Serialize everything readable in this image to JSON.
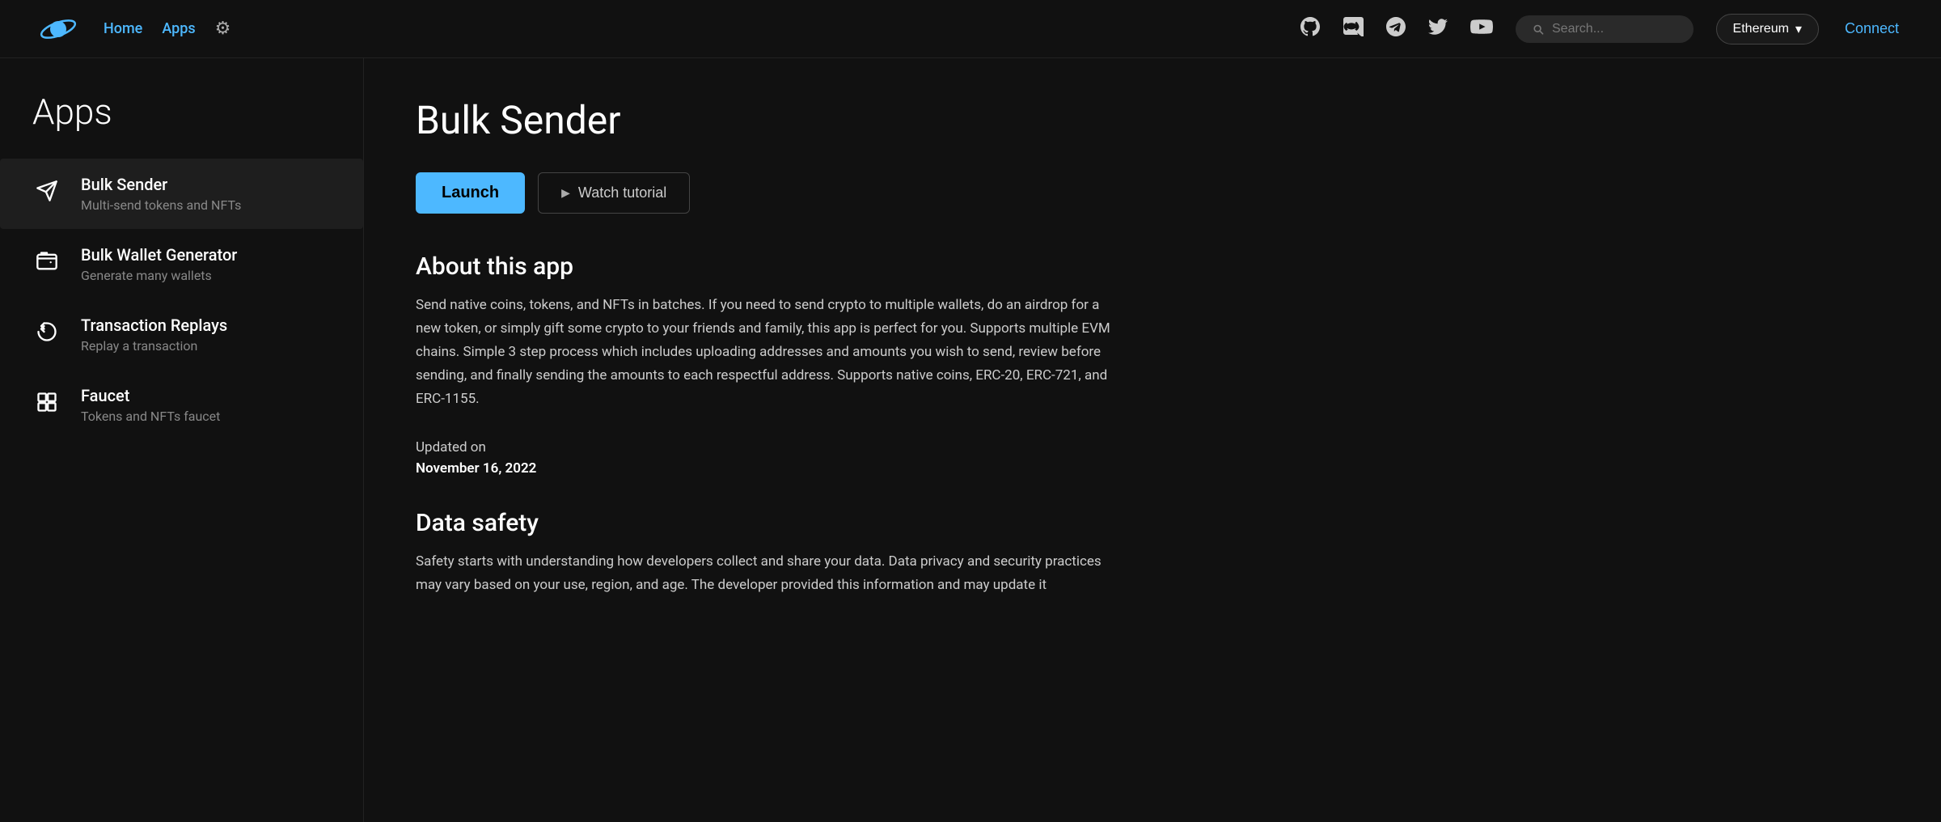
{
  "header": {
    "nav": [
      {
        "label": "Home",
        "id": "home"
      },
      {
        "label": "Apps",
        "id": "apps"
      }
    ],
    "search_placeholder": "Search...",
    "network": "Ethereum",
    "connect_label": "Connect"
  },
  "sidebar": {
    "title": "Apps",
    "items": [
      {
        "id": "bulk-sender",
        "name": "Bulk Sender",
        "desc": "Multi-send tokens and NFTs",
        "icon": "send"
      },
      {
        "id": "bulk-wallet-generator",
        "name": "Bulk Wallet Generator",
        "desc": "Generate many wallets",
        "icon": "wallet"
      },
      {
        "id": "transaction-replays",
        "name": "Transaction Replays",
        "desc": "Replay a transaction",
        "icon": "replay"
      },
      {
        "id": "faucet",
        "name": "Faucet",
        "desc": "Tokens and NFTs faucet",
        "icon": "faucet"
      }
    ]
  },
  "content": {
    "app_title": "Bulk Sender",
    "launch_label": "Launch",
    "watch_tutorial_label": "Watch tutorial",
    "about_title": "About this app",
    "about_text": "Send native coins, tokens, and NFTs in batches. If you need to send crypto to multiple wallets, do an airdrop for a new token, or simply gift some crypto to your friends and family, this app is perfect for you. Supports multiple EVM chains. Simple 3 step process which includes uploading addresses and amounts you wish to send, review before sending, and finally sending the amounts to each respectful address. Supports native coins, ERC-20, ERC-721, and ERC-1155.",
    "updated_label": "Updated on",
    "updated_date": "November 16, 2022",
    "data_safety_title": "Data safety",
    "data_safety_text": "Safety starts with understanding how developers collect and share your data. Data privacy and security practices may vary based on your use, region, and age. The developer provided this information and may update it"
  }
}
